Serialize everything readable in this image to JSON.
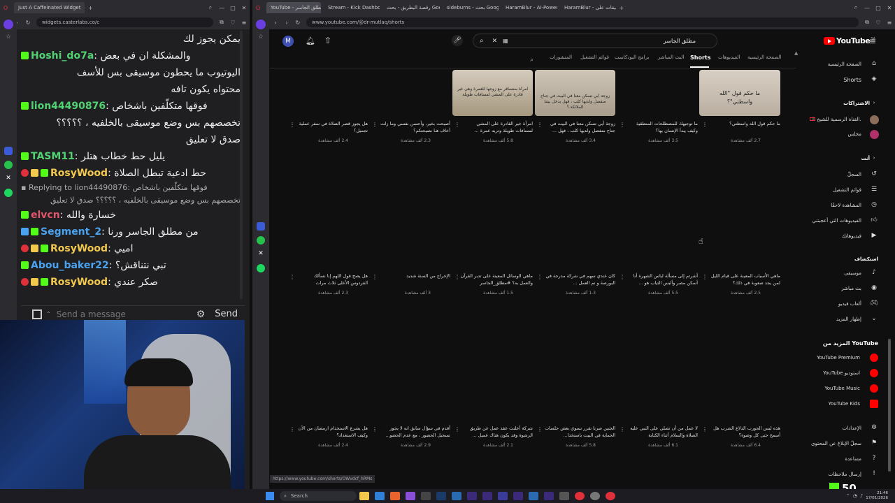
{
  "left_browser": {
    "tab_title": "Just A Caffeinated Widget",
    "url": "widgets.casterlabs.co/c"
  },
  "chat": {
    "messages": [
      {
        "user": "",
        "text": "يمكن يجوز لك",
        "user_color": "#eeeeee"
      },
      {
        "user": "Hoshi_do7a",
        "text": "والمشكلة ان في بعض",
        "user_color": "#52d273"
      },
      {
        "user": "",
        "text": "اليوتيوب ما يحطون موسيقى بس للأسف",
        "user_color": "#eeeeee"
      },
      {
        "user": "",
        "text": "محتواه يكون تافه",
        "user_color": "#eeeeee"
      },
      {
        "user": "lion44490876",
        "text": "فوقها متكلّفين باشخاص",
        "user_color": "#52d273"
      },
      {
        "user": "",
        "text": "تخصصهم بس وضع موسيقى بالخلفيه ، ؟؟؟؟؟",
        "user_color": "#eeeeee"
      },
      {
        "user": "",
        "text": "صدق لا تعليق",
        "user_color": "#eeeeee"
      },
      {
        "user": "TASM11",
        "text": "يليل حط خطاب هتلر",
        "user_color": "#52d273"
      },
      {
        "user": "RosyWood",
        "text": "حط ادعية تبطل الصلاة",
        "user_color": "#f2c94c"
      },
      {
        "user": "Replying to lion44490876",
        "text": "فوقها متكلّفين باشخاص",
        "user_color": "#aaaaaa"
      },
      {
        "user": "",
        "text": "تخصصهم بس وضع موسيقى بالخلفيه ، ؟؟؟؟؟ صدق لا تعليق",
        "user_color": "#aaaaaa"
      },
      {
        "user": "elvcn",
        "text": "خسارة والله",
        "user_color": "#e0556b"
      },
      {
        "user": "Segment_2",
        "text": "من مطلق الجاسر ورنا",
        "user_color": "#4aa3f0"
      },
      {
        "user": "RosyWood",
        "text": "اميي",
        "user_color": "#f2c94c"
      },
      {
        "user": "Abou_baker22",
        "text": "تبي نتناقش؟",
        "user_color": "#4aa3f0"
      },
      {
        "user": "RosyWood",
        "text": "صكر عندي",
        "user_color": "#f2c94c"
      }
    ],
    "input_placeholder": "Send a message",
    "send_label": "Send"
  },
  "right_browser": {
    "tabs": [
      "YouTube - د. مطلق الجاسر",
      "Stream - Kick Dashboard",
      "رقصة البطريق - بحث Google",
      "sideburns - بحث Google",
      "HaramBlur - AI-Powered",
      "HaramBlur - تطبيقات على"
    ],
    "url": "www.youtube.com/@dr-mutlaq/shorts",
    "status_url": "https://www.youtube.com/shorts/OWvdcf_hRMs"
  },
  "youtube": {
    "search_value": "مطلق الجاسر",
    "avatar_letter": "M",
    "logo": "YouTube",
    "logo_suffix": "SA",
    "chips": [
      "الصفحة الرئيسية",
      "الفيديوهات",
      "Shorts",
      "البث المباشر",
      "برامج البودكاست",
      "قوائم التشغيل",
      "المنشورات"
    ],
    "active_chip": "Shorts",
    "sidebar": {
      "home": "الصفحة الرئيسية",
      "shorts": "Shorts",
      "subs_head": "الاشتراكات",
      "subs": [
        "القناة الرسمية للشيخ نا...",
        "مجلس"
      ],
      "you_head": "أنت",
      "you_items": [
        "السجلّ",
        "قوائم التشغيل",
        "المشاهدة لاحقًا",
        "الفيديوهات التي أعجبتني",
        "فيديوهاتك"
      ],
      "explore_head": "استكشاف",
      "explore_items": [
        "موسيقى",
        "بث مباشر",
        "ألعاب فيديو",
        "إظهار المزيد"
      ],
      "more_head": "المزيد من YouTube",
      "more_items": [
        "YouTube Premium",
        "YouTube استوديو",
        "YouTube Music",
        "YouTube Kids"
      ],
      "bottom_items": [
        "الإعدادات",
        "سجلّ الإبلاغ عن المحتوى",
        "مساعدة",
        "إرسال ملاحظات"
      ]
    },
    "rows": [
      [
        {
          "title": "ما حكم قول الله واسطتي؟",
          "views": "2.7 ألف مشاهدة",
          "thumb_text": "ما حكم قول \"الله واسطتي\"؟"
        },
        {
          "title": "ما توجيهك للمصطلحات المنطقية وكيف يبدأ الإنسان بها؟",
          "views": "3.5 ألف مشاهدة",
          "thumb_text": ""
        },
        {
          "title": "زوجة أبي تسكن معنا في البيت في جناح منفصل ولديها كلب ، فهل ...",
          "views": "3.4 ألف مشاهدة",
          "thumb_text": "زوجة أبي تسكن معنا في البيت في جناح منفصل ولديها كلب ، فهل يدخل بيتنا الملائكة ؟"
        },
        {
          "title": "امرأة خير القادرة على المشي لمسافات طويلة وتريد عمرة ...",
          "views": "5.8 ألف مشاهدة",
          "thumb_text": "امرأة ستسافر مع زوجها للعمرة وهي غير قادرة على المشي لمسافات طويلة"
        },
        {
          "title": "أصبحت بخير، وأحسن نفسي وما زلت أخاف هـا نصيحتكم؟",
          "views": "2.3 ألف مشاهدة",
          "thumb_text": ""
        },
        {
          "title": "هل يجوز قصر الصلاة في سفر عملية تجميل؟",
          "views": "2.4 ألف مشاهدة",
          "thumb_text": ""
        }
      ],
      [
        {
          "title": "ماهي الأسباب المعينة على قيام الليل لمن يجد صعوبة في ذلك؟",
          "views": "2.5 ألف مشاهدة"
        },
        {
          "title": "أشرتم إلى مسألة لباس الشهرة أنا أسكن مصر وألبس الثياب هو ...",
          "views": "5.5 ألف مشاهدة"
        },
        {
          "title": "كان عندي سهم في شركة مدرجة في البورصة و تم العمل ...",
          "views": "1.3 ألف مشاهدة"
        },
        {
          "title": "ماهي الوسائل المعينة على تدبر القرآن والعمل به؟ #مطلق_الجاسر",
          "views": "1.5 ألف مشاهدة"
        },
        {
          "title": "الإخراج من السنة شديد",
          "views": "3 ألف مشاهدة"
        },
        {
          "title": "هل يصح قول اللهم إنا نسألك الفردوس الأعلى ثلاث مرات",
          "views": "2.3 ألف مشاهدة"
        }
      ],
      [
        {
          "title": "هذه لبس الجورب الدلاع الشرب هل أسمح حتى كل وضوء؟",
          "views": "6.4 ألف مشاهدة"
        },
        {
          "title": "لا عمل من أن تصلي على النبي عليه الصلاة والسلام أثناء الكتابة",
          "views": "6.1 ألف مشاهدة"
        },
        {
          "title": "الجنين صرنا نقرر نسوي بعض جلسات الحماية في البيت باستخدا...",
          "views": "5.8 ألف مشاهدة"
        },
        {
          "title": "شركة أعلنت عقد عمل عن طريق الرشوة وقد يكون هناك عميل ...",
          "views": "2.1 ألف مشاهدة"
        },
        {
          "title": "أقدم في سؤال سابق انه لا يجوز تسجيل الحضور ، مع عدم الحضو...",
          "views": "2.9 ألف مشاهدة"
        },
        {
          "title": "هل يشرع الاستخدام ارمضان من الآن وكيف الاستعداد؟",
          "views": "2.4 ألف مشاهدة"
        }
      ]
    ]
  },
  "overlay": {
    "kick_count": "50"
  },
  "taskbar": {
    "search_label": "Search",
    "time": "21:46",
    "date": "17/01/2026"
  },
  "colors": {
    "kick_green": "#53fc18",
    "youtube_red": "#ff0000",
    "chip_active": "#ffffff"
  }
}
